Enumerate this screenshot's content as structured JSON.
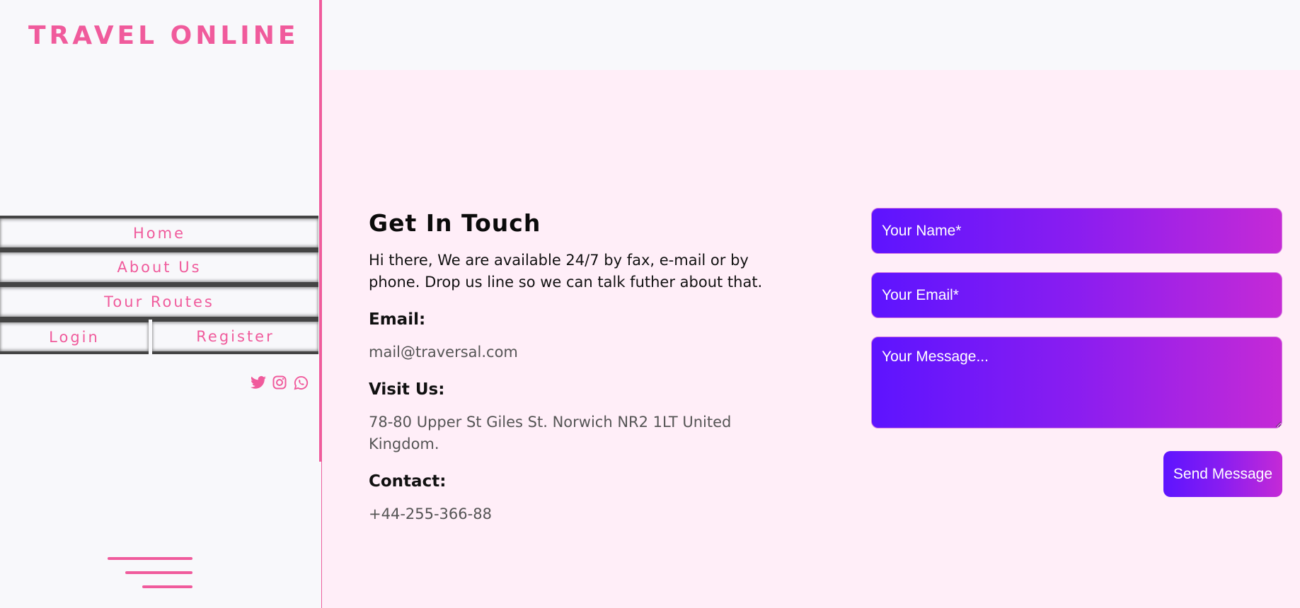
{
  "brand": {
    "logo": "TRAVEL ONLINE",
    "accent": "#f05b9c"
  },
  "nav": {
    "home": "Home",
    "about": "About Us",
    "tours": "Tour Routes",
    "login": "Login",
    "register": "Register"
  },
  "social": [
    "twitter-icon",
    "instagram-icon",
    "whatsapp-icon"
  ],
  "contact": {
    "title": "Get In Touch",
    "intro": "Hi there, We are available 24/7 by fax, e-mail or by phone. Drop us line so we can talk futher about that.",
    "email_label": "Email:",
    "email_value": "mail@traversal.com",
    "visit_label": "Visit Us:",
    "visit_value": "78-80 Upper St Giles St. Norwich NR2 1LT United Kingdom.",
    "contact_label": "Contact:",
    "contact_value": "+44-255-366-88"
  },
  "form": {
    "name_placeholder": "Your Name*",
    "email_placeholder": "Your Email*",
    "message_placeholder": "Your Message...",
    "send_label": "Send Message"
  }
}
